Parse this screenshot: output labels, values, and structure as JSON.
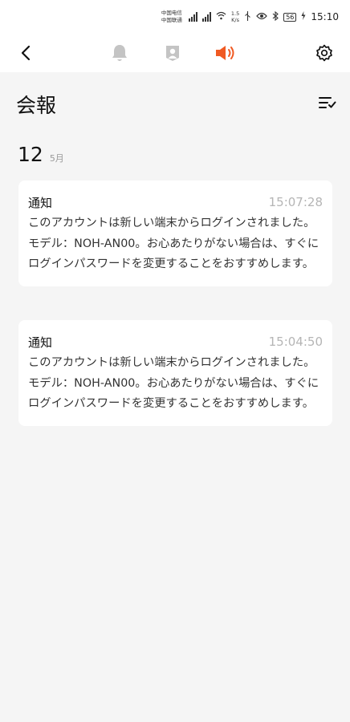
{
  "status_bar": {
    "carrier_1": "中国电信",
    "carrier_2": "中国联通",
    "net_speed_value": "1.5",
    "net_speed_unit": "K/s",
    "battery": "56",
    "time": "15:10"
  },
  "nav": {
    "active_tab": "speaker",
    "accent_color": "#f05a23",
    "inactive_color": "#c4c4c4"
  },
  "page": {
    "title": "会報"
  },
  "date_group": {
    "day": "12",
    "month": "5月"
  },
  "messages": [
    {
      "type": "通知",
      "time": "15:07:28",
      "body": "このアカウントは新しい端末からログインされました。モデル：NOH-AN00。お心あたりがない場合は、すぐにログインパスワードを変更することをおすすめします。"
    },
    {
      "type": "通知",
      "time": "15:04:50",
      "body": "このアカウントは新しい端末からログインされました。モデル：NOH-AN00。お心あたりがない場合は、すぐにログインパスワードを変更することをおすすめします。"
    }
  ]
}
